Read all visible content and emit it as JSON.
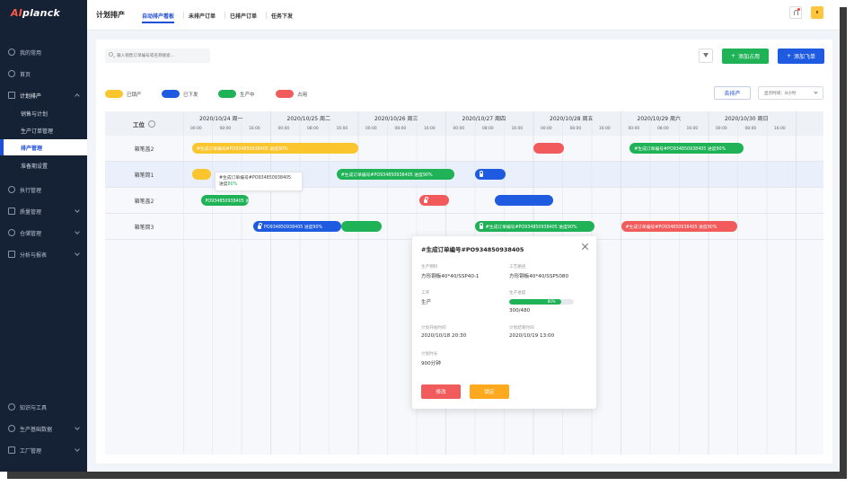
{
  "colors": {
    "sidebar_bg": "#152236",
    "accent_blue": "#1f4ed8",
    "green": "#20b257",
    "yellow": "#fbc52e",
    "red": "#f25b5b",
    "bar_blue": "#1f5be0"
  },
  "app": {
    "logo": "Aiplanck",
    "logo_ai": "AI",
    "logo_rest": "planck"
  },
  "sidebar": {
    "items": [
      {
        "label": "我的常用",
        "icon": "star-circle-icon"
      },
      {
        "label": "首页",
        "icon": "compass-icon"
      },
      {
        "label": "计划排产",
        "icon": "list-icon",
        "open": true,
        "children": [
          "销售与计划",
          "生产订单管理",
          "排产管理",
          "准备期设置"
        ],
        "active_child": 2
      },
      {
        "label": "执行管理",
        "icon": "play-circle-icon"
      },
      {
        "label": "质量管理",
        "icon": "shield-icon"
      },
      {
        "label": "仓储管理",
        "icon": "warehouse-icon"
      },
      {
        "label": "分析与报表",
        "icon": "chart-icon"
      }
    ],
    "bottom_items": [
      {
        "label": "知识与工具",
        "icon": "bulb-icon"
      },
      {
        "label": "生产基础数据",
        "icon": "database-icon"
      },
      {
        "label": "工厂管理",
        "icon": "factory-icon"
      }
    ]
  },
  "header": {
    "title": "计划排产",
    "tabs": [
      "自动排产看板",
      "未排产订单",
      "已排产订单",
      "任务下发"
    ],
    "active_tab": 0
  },
  "toolbar": {
    "search_placeholder": "输入销售订单编号或名称搜索...",
    "add_occupy": "添加占用",
    "add_plane": "添加飞单",
    "goto_schedule": "去排产",
    "time_unit": "显示时间：8小时"
  },
  "legend": [
    {
      "label": "已锁产",
      "color": "#fbc52e"
    },
    {
      "label": "已下发",
      "color": "#1f5be0"
    },
    {
      "label": "生产中",
      "color": "#20b257"
    },
    {
      "label": "占用",
      "color": "#f25b5b"
    }
  ],
  "gantt": {
    "station_header": "工位",
    "days": [
      {
        "date": "2020/10/24",
        "weekday": "周一"
      },
      {
        "date": "2020/10/25",
        "weekday": "周二"
      },
      {
        "date": "2020/10/26",
        "weekday": "周三"
      },
      {
        "date": "2020/10/27",
        "weekday": "周四"
      },
      {
        "date": "2020/10/28",
        "weekday": "周五"
      },
      {
        "date": "2020/10/29",
        "weekday": "周六"
      },
      {
        "date": "2020/10/30",
        "weekday": "周日"
      }
    ],
    "hours": [
      "00:00",
      "08:00",
      "16:00"
    ],
    "rows": [
      "箱笔盖2",
      "箱笔筒1",
      "箱笔盖2",
      "箱笔筒3"
    ],
    "bars": [
      {
        "row": 0,
        "start_day": 0.1,
        "end_day": 2.0,
        "color": "yellow",
        "text": "#生成订单编号#PO934850938405   进度90%"
      },
      {
        "row": 0,
        "start_day": 4.0,
        "end_day": 4.35,
        "color": "red",
        "text": ""
      },
      {
        "row": 0,
        "start_day": 5.1,
        "end_day": 6.4,
        "color": "green",
        "text": "#生成订单编号#PO934850938405   进度90%"
      },
      {
        "row": 1,
        "start_day": 0.1,
        "end_day": 0.32,
        "color": "yellow",
        "text": ""
      },
      {
        "row": 1,
        "start_day": 1.75,
        "end_day": 3.1,
        "color": "green",
        "text": "#生成订单编号#PO934850938405   进度90%"
      },
      {
        "row": 1,
        "start_day": 3.33,
        "end_day": 3.68,
        "color": "blue",
        "text": "",
        "locked": true
      },
      {
        "row": 2,
        "start_day": 0.2,
        "end_day": 0.75,
        "color": "green",
        "text": "PO934850938405   进度90%"
      },
      {
        "row": 2,
        "start_day": 2.7,
        "end_day": 3.04,
        "color": "red",
        "text": "",
        "locked": true
      },
      {
        "row": 2,
        "start_day": 3.56,
        "end_day": 4.23,
        "color": "blue",
        "text": ""
      },
      {
        "row": 3,
        "start_day": 0.8,
        "end_day": 1.8,
        "color": "blue",
        "text": "PO934850938405   进度90%",
        "locked": true
      },
      {
        "row": 3,
        "start_day": 1.8,
        "end_day": 2.27,
        "color": "green",
        "text": ""
      },
      {
        "row": 3,
        "start_day": 3.33,
        "end_day": 4.7,
        "color": "green",
        "text": "#生成订单编号#PO934850938405   进度90%",
        "locked": true
      },
      {
        "row": 3,
        "start_day": 5.0,
        "end_day": 6.33,
        "color": "red",
        "text": "#生成订单编号#PO934850938405   进度90%"
      }
    ],
    "tooltip": {
      "line1": "#生成订单编号#PO934850938405",
      "line2_prefix": "进度",
      "line2_value": "80%"
    }
  },
  "detail": {
    "title": "#生成订单编号#PO934850938405",
    "fields": [
      {
        "label": "生产物料",
        "value": "方形钢板40*40/SSP40-1"
      },
      {
        "label": "工艺路径",
        "value": "方形钢板40*40/SSP5080"
      },
      {
        "label": "工序",
        "value": "生产"
      },
      {
        "label": "生产进度",
        "value": "300/480"
      },
      {
        "label": "计划开始时间",
        "value": "2020/10/18 20:30"
      },
      {
        "label": "计划结束时间",
        "value": "2020/10/19 13:00"
      },
      {
        "label": "计划时长",
        "value": "900分钟"
      }
    ],
    "progress": 0.8,
    "progress_text": "80%",
    "modify": "修改",
    "lock": "锁定"
  }
}
